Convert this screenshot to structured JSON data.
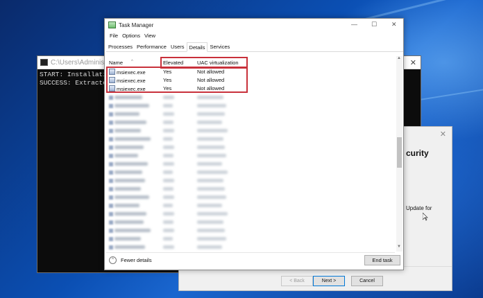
{
  "console": {
    "title": "C:\\Users\\Administrator\\D",
    "lines": [
      "START: Installation p",
      "SUCCESS: Extracted co"
    ]
  },
  "installer": {
    "heading_fragment": "curity",
    "text_fragment": "Update for",
    "back_label": "< Back",
    "next_label": "Next >",
    "cancel_label": "Cancel"
  },
  "task_manager": {
    "title": "Task Manager",
    "menu": [
      "File",
      "Options",
      "View"
    ],
    "tabs": [
      "Processes",
      "Performance",
      "Users",
      "Details",
      "Services"
    ],
    "active_tab": "Details",
    "columns": [
      "Name",
      "Elevated",
      "UAC virtualization"
    ],
    "rows": [
      {
        "name": "msiexec.exe",
        "elevated": "Yes",
        "uac": "Not allowed"
      },
      {
        "name": "msiexec.exe",
        "elevated": "Yes",
        "uac": "Not allowed"
      },
      {
        "name": "msiexec.exe",
        "elevated": "Yes",
        "uac": "Not allowed"
      }
    ],
    "fewer_details_label": "Fewer details",
    "end_task_label": "End task"
  },
  "colors": {
    "highlight_box": "#c8303a",
    "wallpaper": "#0b4fb3"
  }
}
